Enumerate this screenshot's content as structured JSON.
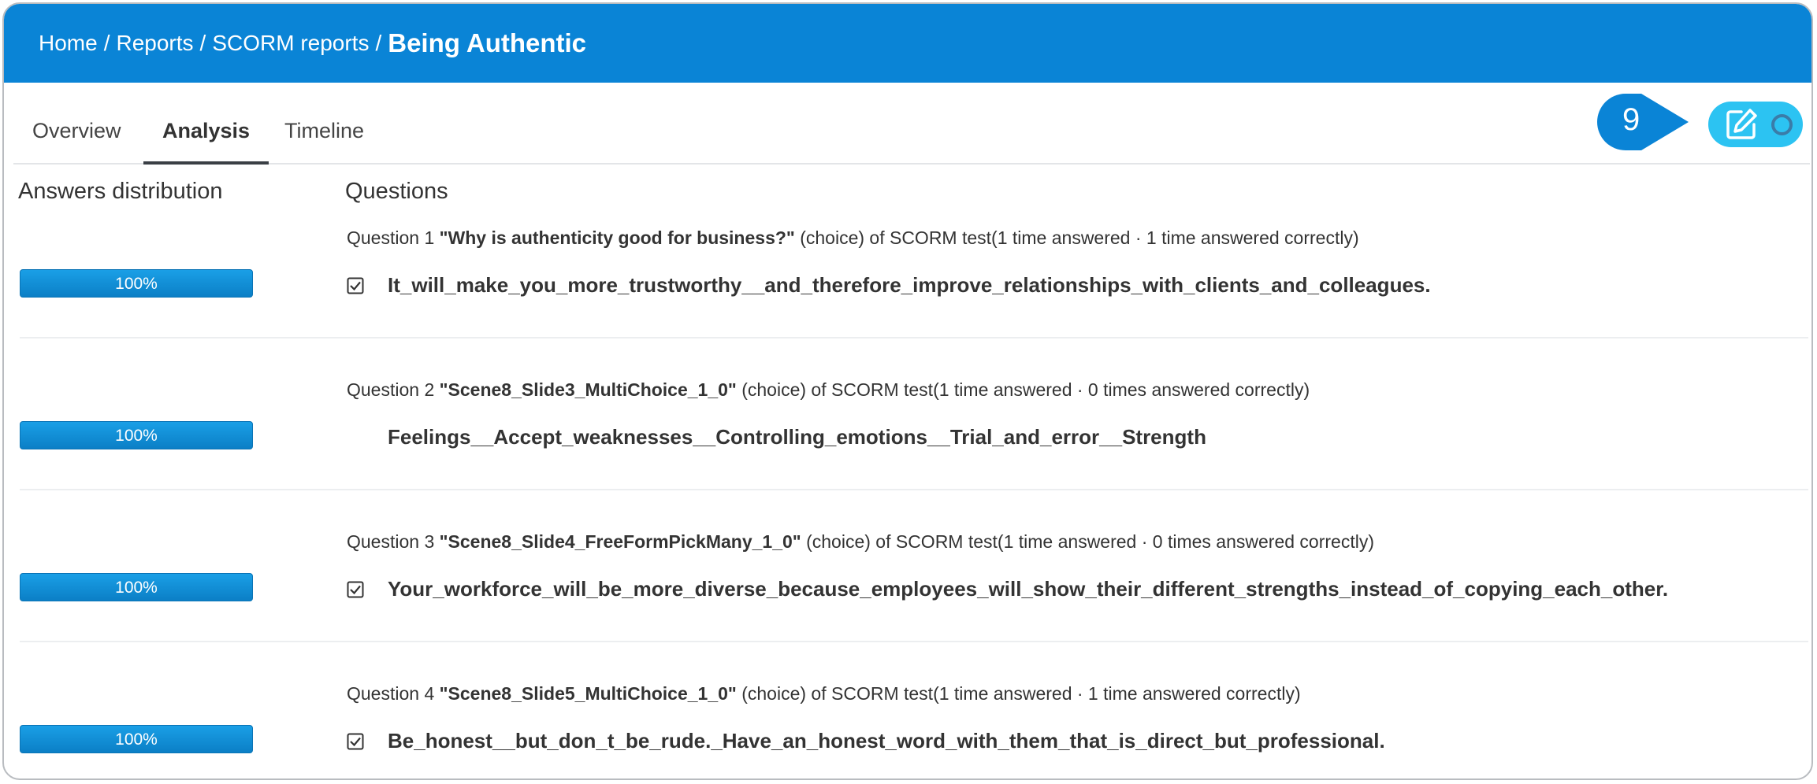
{
  "breadcrumb": {
    "items": [
      "Home",
      "Reports",
      "SCORM reports"
    ],
    "separator": "/",
    "current": "Being Authentic"
  },
  "tabs": [
    "Overview",
    "Analysis",
    "Timeline"
  ],
  "active_tab": "Analysis",
  "step_marker": {
    "label": "9",
    "color": "#0a84d6"
  },
  "colors": {
    "header": "#0a84d6",
    "accent": "#2cc3f2",
    "bar": "#1a9fe6"
  },
  "columns": {
    "left": "Answers distribution",
    "right": "Questions"
  },
  "questions": [
    {
      "label": "Question 1",
      "title": "\"Why is authenticity good for business?\"",
      "meta": "(choice) of SCORM test(1 time answered · 1 time answered correctly)",
      "answer": "It_will_make_you_more_trustworthy__and_therefore_improve_relationships_with_clients_and_colleagues.",
      "checked": true,
      "percent": "100%"
    },
    {
      "label": "Question 2",
      "title": "\"Scene8_Slide3_MultiChoice_1_0\"",
      "meta": "(choice) of SCORM test(1 time answered · 0 times answered correctly)",
      "answer": "Feelings__Accept_weaknesses__Controlling_emotions__Trial_and_error__Strength",
      "checked": false,
      "percent": "100%"
    },
    {
      "label": "Question 3",
      "title": "\"Scene8_Slide4_FreeFormPickMany_1_0\"",
      "meta": "(choice) of SCORM test(1 time answered · 0 times answered correctly)",
      "answer": "Your_workforce_will_be_more_diverse_because_employees_will_show_their_different_strengths_instead_of_copying_each_other.",
      "checked": true,
      "percent": "100%"
    },
    {
      "label": "Question 4",
      "title": "\"Scene8_Slide5_MultiChoice_1_0\"",
      "meta": "(choice) of SCORM test(1 time answered · 1 time answered correctly)",
      "answer": "Be_honest__but_don_t_be_rude._Have_an_honest_word_with_them_that_is_direct_but_professional.",
      "checked": true,
      "percent": "100%"
    }
  ]
}
